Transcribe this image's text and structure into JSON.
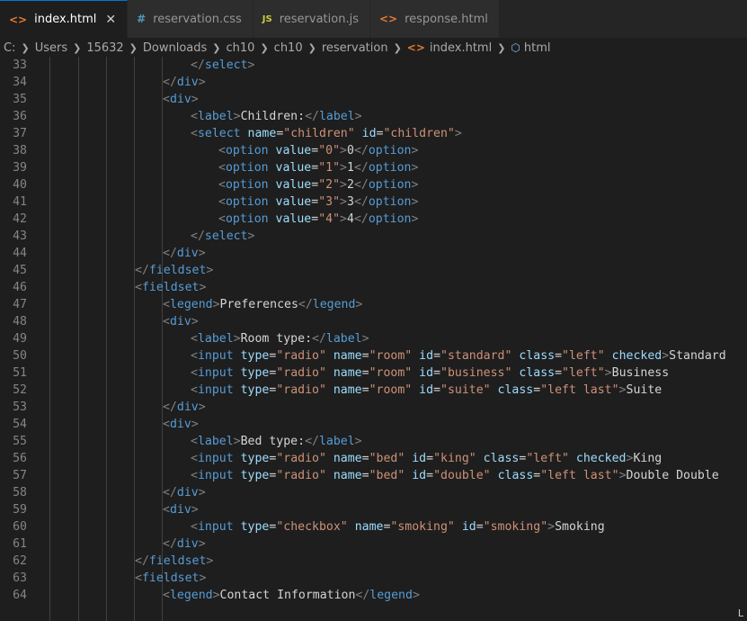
{
  "tabs": [
    {
      "label": "index.html",
      "icon": "html-file-icon",
      "active": true
    },
    {
      "label": "reservation.css",
      "icon": "css-file-icon",
      "active": false
    },
    {
      "label": "reservation.js",
      "icon": "js-file-icon",
      "active": false
    },
    {
      "label": "response.html",
      "icon": "html-file-icon",
      "active": false
    }
  ],
  "breadcrumb": [
    "C:",
    "Users",
    "15632",
    "Downloads",
    "ch10",
    "ch10",
    "reservation",
    "index.html",
    "html"
  ],
  "editor": {
    "lines": [
      {
        "n": "33",
        "indent": 5,
        "html": "<span class=\"t-punc\">&lt;/</span><span class=\"t-tag\">select</span><span class=\"t-punc\">&gt;</span>"
      },
      {
        "n": "34",
        "indent": 4,
        "html": "<span class=\"t-punc\">&lt;/</span><span class=\"t-tag\">div</span><span class=\"t-punc\">&gt;</span>"
      },
      {
        "n": "35",
        "indent": 4,
        "html": "<span class=\"t-punc\">&lt;</span><span class=\"t-tag\">div</span><span class=\"t-punc\">&gt;</span>"
      },
      {
        "n": "36",
        "indent": 5,
        "html": "<span class=\"t-punc\">&lt;</span><span class=\"t-tag\">label</span><span class=\"t-punc\">&gt;</span><span class=\"t-text\">Children:</span><span class=\"t-punc\">&lt;/</span><span class=\"t-tag\">label</span><span class=\"t-punc\">&gt;</span>"
      },
      {
        "n": "37",
        "indent": 5,
        "html": "<span class=\"t-punc\">&lt;</span><span class=\"t-tag\">select</span> <span class=\"t-attr\">name</span><span class=\"t-text\">=</span><span class=\"t-str\">\"children\"</span> <span class=\"t-attr\">id</span><span class=\"t-text\">=</span><span class=\"t-str\">\"children\"</span><span class=\"t-punc\">&gt;</span>"
      },
      {
        "n": "38",
        "indent": 6,
        "html": "<span class=\"t-punc\">&lt;</span><span class=\"t-tag\">option</span> <span class=\"t-attr\">value</span><span class=\"t-text\">=</span><span class=\"t-str\">\"0\"</span><span class=\"t-punc\">&gt;</span><span class=\"t-text\">0</span><span class=\"t-punc\">&lt;/</span><span class=\"t-tag\">option</span><span class=\"t-punc\">&gt;</span>"
      },
      {
        "n": "39",
        "indent": 6,
        "html": "<span class=\"t-punc\">&lt;</span><span class=\"t-tag\">option</span> <span class=\"t-attr\">value</span><span class=\"t-text\">=</span><span class=\"t-str\">\"1\"</span><span class=\"t-punc\">&gt;</span><span class=\"t-text\">1</span><span class=\"t-punc\">&lt;/</span><span class=\"t-tag\">option</span><span class=\"t-punc\">&gt;</span>"
      },
      {
        "n": "40",
        "indent": 6,
        "html": "<span class=\"t-punc\">&lt;</span><span class=\"t-tag\">option</span> <span class=\"t-attr\">value</span><span class=\"t-text\">=</span><span class=\"t-str\">\"2\"</span><span class=\"t-punc\">&gt;</span><span class=\"t-text\">2</span><span class=\"t-punc\">&lt;/</span><span class=\"t-tag\">option</span><span class=\"t-punc\">&gt;</span>"
      },
      {
        "n": "41",
        "indent": 6,
        "html": "<span class=\"t-punc\">&lt;</span><span class=\"t-tag\">option</span> <span class=\"t-attr\">value</span><span class=\"t-text\">=</span><span class=\"t-str\">\"3\"</span><span class=\"t-punc\">&gt;</span><span class=\"t-text\">3</span><span class=\"t-punc\">&lt;/</span><span class=\"t-tag\">option</span><span class=\"t-punc\">&gt;</span>"
      },
      {
        "n": "42",
        "indent": 6,
        "html": "<span class=\"t-punc\">&lt;</span><span class=\"t-tag\">option</span> <span class=\"t-attr\">value</span><span class=\"t-text\">=</span><span class=\"t-str\">\"4\"</span><span class=\"t-punc\">&gt;</span><span class=\"t-text\">4</span><span class=\"t-punc\">&lt;/</span><span class=\"t-tag\">option</span><span class=\"t-punc\">&gt;</span>"
      },
      {
        "n": "43",
        "indent": 5,
        "html": "<span class=\"t-punc\">&lt;/</span><span class=\"t-tag\">select</span><span class=\"t-punc\">&gt;</span>"
      },
      {
        "n": "44",
        "indent": 4,
        "html": "<span class=\"t-punc\">&lt;/</span><span class=\"t-tag\">div</span><span class=\"t-punc\">&gt;</span>"
      },
      {
        "n": "45",
        "indent": 3,
        "html": "<span class=\"t-punc\">&lt;/</span><span class=\"t-tag\">fieldset</span><span class=\"t-punc\">&gt;</span>"
      },
      {
        "n": "46",
        "indent": 3,
        "html": "<span class=\"t-punc\">&lt;</span><span class=\"t-tag\">fieldset</span><span class=\"t-punc\">&gt;</span>"
      },
      {
        "n": "47",
        "indent": 4,
        "html": "<span class=\"t-punc\">&lt;</span><span class=\"t-tag\">legend</span><span class=\"t-punc\">&gt;</span><span class=\"t-text\">Preferences</span><span class=\"t-punc\">&lt;/</span><span class=\"t-tag\">legend</span><span class=\"t-punc\">&gt;</span>"
      },
      {
        "n": "48",
        "indent": 4,
        "html": "<span class=\"t-punc\">&lt;</span><span class=\"t-tag\">div</span><span class=\"t-punc\">&gt;</span>"
      },
      {
        "n": "49",
        "indent": 5,
        "html": "<span class=\"t-punc\">&lt;</span><span class=\"t-tag\">label</span><span class=\"t-punc\">&gt;</span><span class=\"t-text\">Room type:</span><span class=\"t-punc\">&lt;/</span><span class=\"t-tag\">label</span><span class=\"t-punc\">&gt;</span>"
      },
      {
        "n": "50",
        "indent": 5,
        "html": "<span class=\"t-punc\">&lt;</span><span class=\"t-tag\">input</span> <span class=\"t-attr\">type</span><span class=\"t-text\">=</span><span class=\"t-str\">\"radio\"</span> <span class=\"t-attr\">name</span><span class=\"t-text\">=</span><span class=\"t-str\">\"room\"</span> <span class=\"t-attr\">id</span><span class=\"t-text\">=</span><span class=\"t-str\">\"standard\"</span> <span class=\"t-attr\">class</span><span class=\"t-text\">=</span><span class=\"t-str\">\"left\"</span> <span class=\"t-attr\">checked</span><span class=\"t-punc\">&gt;</span><span class=\"t-text\">Standard</span>"
      },
      {
        "n": "51",
        "indent": 5,
        "html": "<span class=\"t-punc\">&lt;</span><span class=\"t-tag\">input</span> <span class=\"t-attr\">type</span><span class=\"t-text\">=</span><span class=\"t-str\">\"radio\"</span> <span class=\"t-attr\">name</span><span class=\"t-text\">=</span><span class=\"t-str\">\"room\"</span> <span class=\"t-attr\">id</span><span class=\"t-text\">=</span><span class=\"t-str\">\"business\"</span> <span class=\"t-attr\">class</span><span class=\"t-text\">=</span><span class=\"t-str\">\"left\"</span><span class=\"t-punc\">&gt;</span><span class=\"t-text\">Business</span>"
      },
      {
        "n": "52",
        "indent": 5,
        "html": "<span class=\"t-punc\">&lt;</span><span class=\"t-tag\">input</span> <span class=\"t-attr\">type</span><span class=\"t-text\">=</span><span class=\"t-str\">\"radio\"</span> <span class=\"t-attr\">name</span><span class=\"t-text\">=</span><span class=\"t-str\">\"room\"</span> <span class=\"t-attr\">id</span><span class=\"t-text\">=</span><span class=\"t-str\">\"suite\"</span> <span class=\"t-attr\">class</span><span class=\"t-text\">=</span><span class=\"t-str\">\"left last\"</span><span class=\"t-punc\">&gt;</span><span class=\"t-text\">Suite</span>"
      },
      {
        "n": "53",
        "indent": 4,
        "html": "<span class=\"t-punc\">&lt;/</span><span class=\"t-tag\">div</span><span class=\"t-punc\">&gt;</span>"
      },
      {
        "n": "54",
        "indent": 4,
        "html": "<span class=\"t-punc\">&lt;</span><span class=\"t-tag\">div</span><span class=\"t-punc\">&gt;</span>"
      },
      {
        "n": "55",
        "indent": 5,
        "html": "<span class=\"t-punc\">&lt;</span><span class=\"t-tag\">label</span><span class=\"t-punc\">&gt;</span><span class=\"t-text\">Bed type:</span><span class=\"t-punc\">&lt;/</span><span class=\"t-tag\">label</span><span class=\"t-punc\">&gt;</span>"
      },
      {
        "n": "56",
        "indent": 5,
        "html": "<span class=\"t-punc\">&lt;</span><span class=\"t-tag\">input</span> <span class=\"t-attr\">type</span><span class=\"t-text\">=</span><span class=\"t-str\">\"radio\"</span> <span class=\"t-attr\">name</span><span class=\"t-text\">=</span><span class=\"t-str\">\"bed\"</span> <span class=\"t-attr\">id</span><span class=\"t-text\">=</span><span class=\"t-str\">\"king\"</span> <span class=\"t-attr\">class</span><span class=\"t-text\">=</span><span class=\"t-str\">\"left\"</span> <span class=\"t-attr\">checked</span><span class=\"t-punc\">&gt;</span><span class=\"t-text\">King</span>"
      },
      {
        "n": "57",
        "indent": 5,
        "html": "<span class=\"t-punc\">&lt;</span><span class=\"t-tag\">input</span> <span class=\"t-attr\">type</span><span class=\"t-text\">=</span><span class=\"t-str\">\"radio\"</span> <span class=\"t-attr\">name</span><span class=\"t-text\">=</span><span class=\"t-str\">\"bed\"</span> <span class=\"t-attr\">id</span><span class=\"t-text\">=</span><span class=\"t-str\">\"double\"</span> <span class=\"t-attr\">class</span><span class=\"t-text\">=</span><span class=\"t-str\">\"left last\"</span><span class=\"t-punc\">&gt;</span><span class=\"t-text\">Double Double</span>"
      },
      {
        "n": "58",
        "indent": 4,
        "html": "<span class=\"t-punc\">&lt;/</span><span class=\"t-tag\">div</span><span class=\"t-punc\">&gt;</span>"
      },
      {
        "n": "59",
        "indent": 4,
        "html": "<span class=\"t-punc\">&lt;</span><span class=\"t-tag\">div</span><span class=\"t-punc\">&gt;</span>"
      },
      {
        "n": "60",
        "indent": 5,
        "html": "<span class=\"t-punc\">&lt;</span><span class=\"t-tag\">input</span> <span class=\"t-attr\">type</span><span class=\"t-text\">=</span><span class=\"t-str\">\"checkbox\"</span> <span class=\"t-attr\">name</span><span class=\"t-text\">=</span><span class=\"t-str\">\"smoking\"</span> <span class=\"t-attr\">id</span><span class=\"t-text\">=</span><span class=\"t-str\">\"smoking\"</span><span class=\"t-punc\">&gt;</span><span class=\"t-text\">Smoking</span>"
      },
      {
        "n": "61",
        "indent": 4,
        "html": "<span class=\"t-punc\">&lt;/</span><span class=\"t-tag\">div</span><span class=\"t-punc\">&gt;</span>"
      },
      {
        "n": "62",
        "indent": 3,
        "html": "<span class=\"t-punc\">&lt;/</span><span class=\"t-tag\">fieldset</span><span class=\"t-punc\">&gt;</span>"
      },
      {
        "n": "63",
        "indent": 3,
        "html": "<span class=\"t-punc\">&lt;</span><span class=\"t-tag\">fieldset</span><span class=\"t-punc\">&gt;</span>"
      },
      {
        "n": "64",
        "indent": 4,
        "html": "<span class=\"t-punc\">&lt;</span><span class=\"t-tag\">legend</span><span class=\"t-punc\">&gt;</span><span class=\"t-text\">Contact Information</span><span class=\"t-punc\">&lt;/</span><span class=\"t-tag\">legend</span><span class=\"t-punc\">&gt;</span>"
      }
    ]
  },
  "status": {
    "corner_text": "L"
  }
}
